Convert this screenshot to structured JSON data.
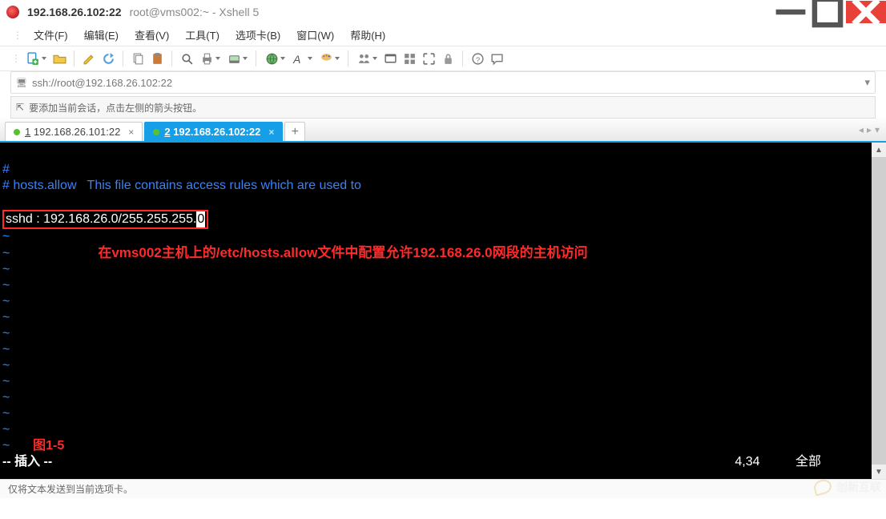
{
  "titlebar": {
    "ip": "192.168.26.102:22",
    "subtitle": "root@vms002:~ - Xshell 5"
  },
  "menu": {
    "file": "文件(F)",
    "edit": "编辑(E)",
    "view": "查看(V)",
    "tools": "工具(T)",
    "tabs": "选项卡(B)",
    "window": "窗口(W)",
    "help": "帮助(H)"
  },
  "address": {
    "url": "ssh://root@192.168.26.102:22"
  },
  "hint": {
    "text": "要添加当前会话，点击左侧的箭头按钮。"
  },
  "tabs": {
    "t1": {
      "idx": "1",
      "label": "192.168.26.101:22"
    },
    "t2": {
      "idx": "2",
      "label": "192.168.26.102:22"
    },
    "add": "+"
  },
  "terminal": {
    "l1": "#",
    "l2": "# hosts.allow   This file contains access rules which are used to",
    "l3_pre": "sshd : 192.168.26.0/255.255.255.",
    "l3_cursor": "0",
    "annotation": "在vms002主机上的/etc/hosts.allow文件中配置允许192.168.26.0网段的主机访问",
    "tilde": "~",
    "fig_label": "图1-5",
    "status_left": "-- 插入 --",
    "status_right": "4,34          全部"
  },
  "statusbar": {
    "text": "仅将文本发送到当前选项卡。"
  },
  "watermark": {
    "text": "创新互联"
  },
  "icons": {
    "new_doc": "new-doc-icon",
    "open": "open-folder-icon",
    "pencil": "pencil-icon",
    "refresh": "refresh-icon",
    "copy": "copy-icon",
    "paste": "paste-icon",
    "search": "search-icon",
    "printer": "printer-icon",
    "server": "server-icon",
    "globe": "globe-icon",
    "font": "font-icon",
    "palette": "palette-icon",
    "users": "users-icon",
    "desktop": "desktop-icon",
    "grid": "grid-icon",
    "expand": "expand-icon",
    "lock": "lock-icon",
    "help": "help-icon",
    "chat": "chat-icon"
  }
}
